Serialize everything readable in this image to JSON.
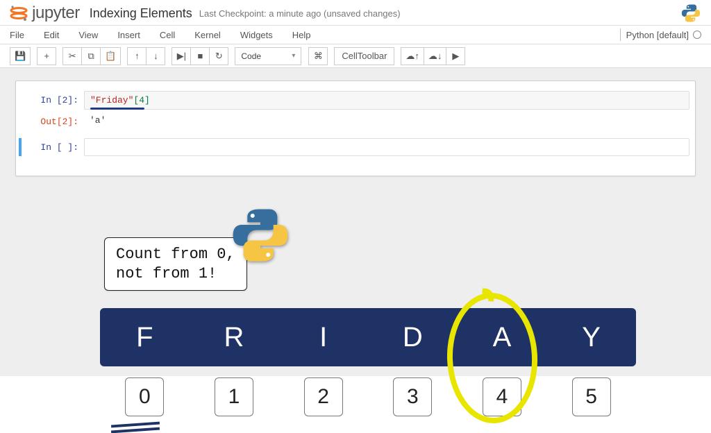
{
  "header": {
    "logo_text_pre": "",
    "notebook_title": "Indexing Elements",
    "checkpoint": "Last Checkpoint: a minute ago (unsaved changes)"
  },
  "menu": {
    "items": [
      "File",
      "Edit",
      "View",
      "Insert",
      "Cell",
      "Kernel",
      "Widgets",
      "Help"
    ],
    "kernel_name": "Python [default]"
  },
  "toolbar": {
    "save_icon": "💾",
    "add_icon": "+",
    "cut_icon": "✂",
    "copy_icon": "⧉",
    "paste_icon": "📋",
    "up_icon": "↑",
    "down_icon": "↓",
    "run_icon": "▶|",
    "stop_icon": "■",
    "restart_icon": "↻",
    "celltype": "Code",
    "cmdpalette_icon": "⌘",
    "celltoolbar_label": "CellToolbar",
    "cloud_up_icon": "☁↑",
    "cloud_dn_icon": "☁↓",
    "present_icon": "▶"
  },
  "cells": {
    "c1": {
      "in_prompt": "In [2]:",
      "code_str": "\"Friday\"",
      "code_brk_open": "[",
      "code_num": "4",
      "code_brk_close": "]",
      "out_prompt": "Out[2]:",
      "out_value": "'a'"
    },
    "c2": {
      "in_prompt": "In [ ]:"
    }
  },
  "annotation": {
    "text": "Count from 0,\nnot from 1!"
  },
  "diagram": {
    "letters": [
      "F",
      "R",
      "I",
      "D",
      "A",
      "Y"
    ],
    "indices": [
      "0",
      "1",
      "2",
      "3",
      "4",
      "5"
    ]
  },
  "icons": {
    "pylogo_name": "python-icon"
  }
}
